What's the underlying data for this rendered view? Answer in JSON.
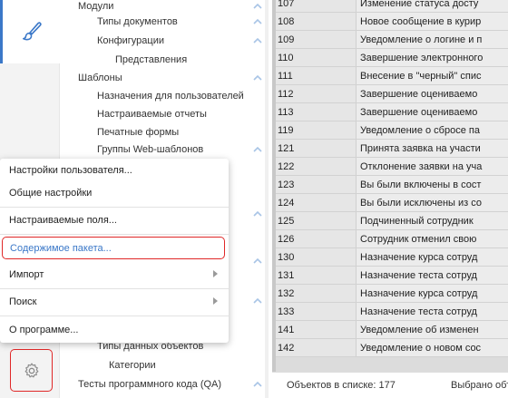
{
  "tree": {
    "items": [
      {
        "label": "Модули"
      },
      {
        "label": "Типы документов"
      },
      {
        "label": "Конфигурации"
      },
      {
        "label": "Представления"
      },
      {
        "label": "Шаблоны"
      },
      {
        "label": "Назначения для пользователей"
      },
      {
        "label": "Настраиваемые отчеты"
      },
      {
        "label": "Печатные формы"
      },
      {
        "label": "Группы Web-шаблонов"
      },
      {
        "label": "Типы данных объектов"
      },
      {
        "label": "Категории"
      },
      {
        "label": "Тесты программного кода (QA)"
      }
    ]
  },
  "menu": {
    "items": [
      {
        "label": "Настройки пользователя..."
      },
      {
        "label": "Общие настройки"
      },
      {
        "label": "Настраиваемые поля..."
      },
      {
        "label": "Содержимое пакета..."
      },
      {
        "label": "Импорт"
      },
      {
        "label": "Поиск"
      },
      {
        "label": "О программе..."
      }
    ]
  },
  "table": {
    "rows": [
      {
        "code": "107",
        "name": "Изменение статуса досту"
      },
      {
        "code": "108",
        "name": "Новое сообщение в курир"
      },
      {
        "code": "109",
        "name": "Уведомление о логине и п"
      },
      {
        "code": "110",
        "name": "Завершение электронного"
      },
      {
        "code": "111",
        "name": "Внесение в \"черный\" спис"
      },
      {
        "code": "112",
        "name": "Завершение оцениваемо"
      },
      {
        "code": "113",
        "name": "Завершение оцениваемо"
      },
      {
        "code": "119",
        "name": "Уведомление о сбросе па"
      },
      {
        "code": "121",
        "name": "Принята заявка на участи"
      },
      {
        "code": "122",
        "name": "Отклонение заявки на уча"
      },
      {
        "code": "123",
        "name": "Вы были включены в сост"
      },
      {
        "code": "124",
        "name": "Вы были исключены из со"
      },
      {
        "code": "125",
        "name": "Подчиненный сотрудник"
      },
      {
        "code": "126",
        "name": "Сотрудник отменил свою"
      },
      {
        "code": "130",
        "name": "Назначение курса сотруд"
      },
      {
        "code": "131",
        "name": "Назначение теста сотруд"
      },
      {
        "code": "132",
        "name": "Назначение курса сотруд"
      },
      {
        "code": "133",
        "name": "Назначение теста сотруд"
      },
      {
        "code": "141",
        "name": "Уведомление об изменен"
      },
      {
        "code": "142",
        "name": "Уведомление о новом сос"
      }
    ]
  },
  "status": {
    "count_text": "Объектов в списке: 177",
    "selected_text": "Выбрано объекто"
  },
  "icons": {
    "rail_active": "brush-icon",
    "settings": "gear-icon"
  },
  "colors": {
    "accent": "#3b78c8",
    "highlight_border": "#e02828"
  }
}
